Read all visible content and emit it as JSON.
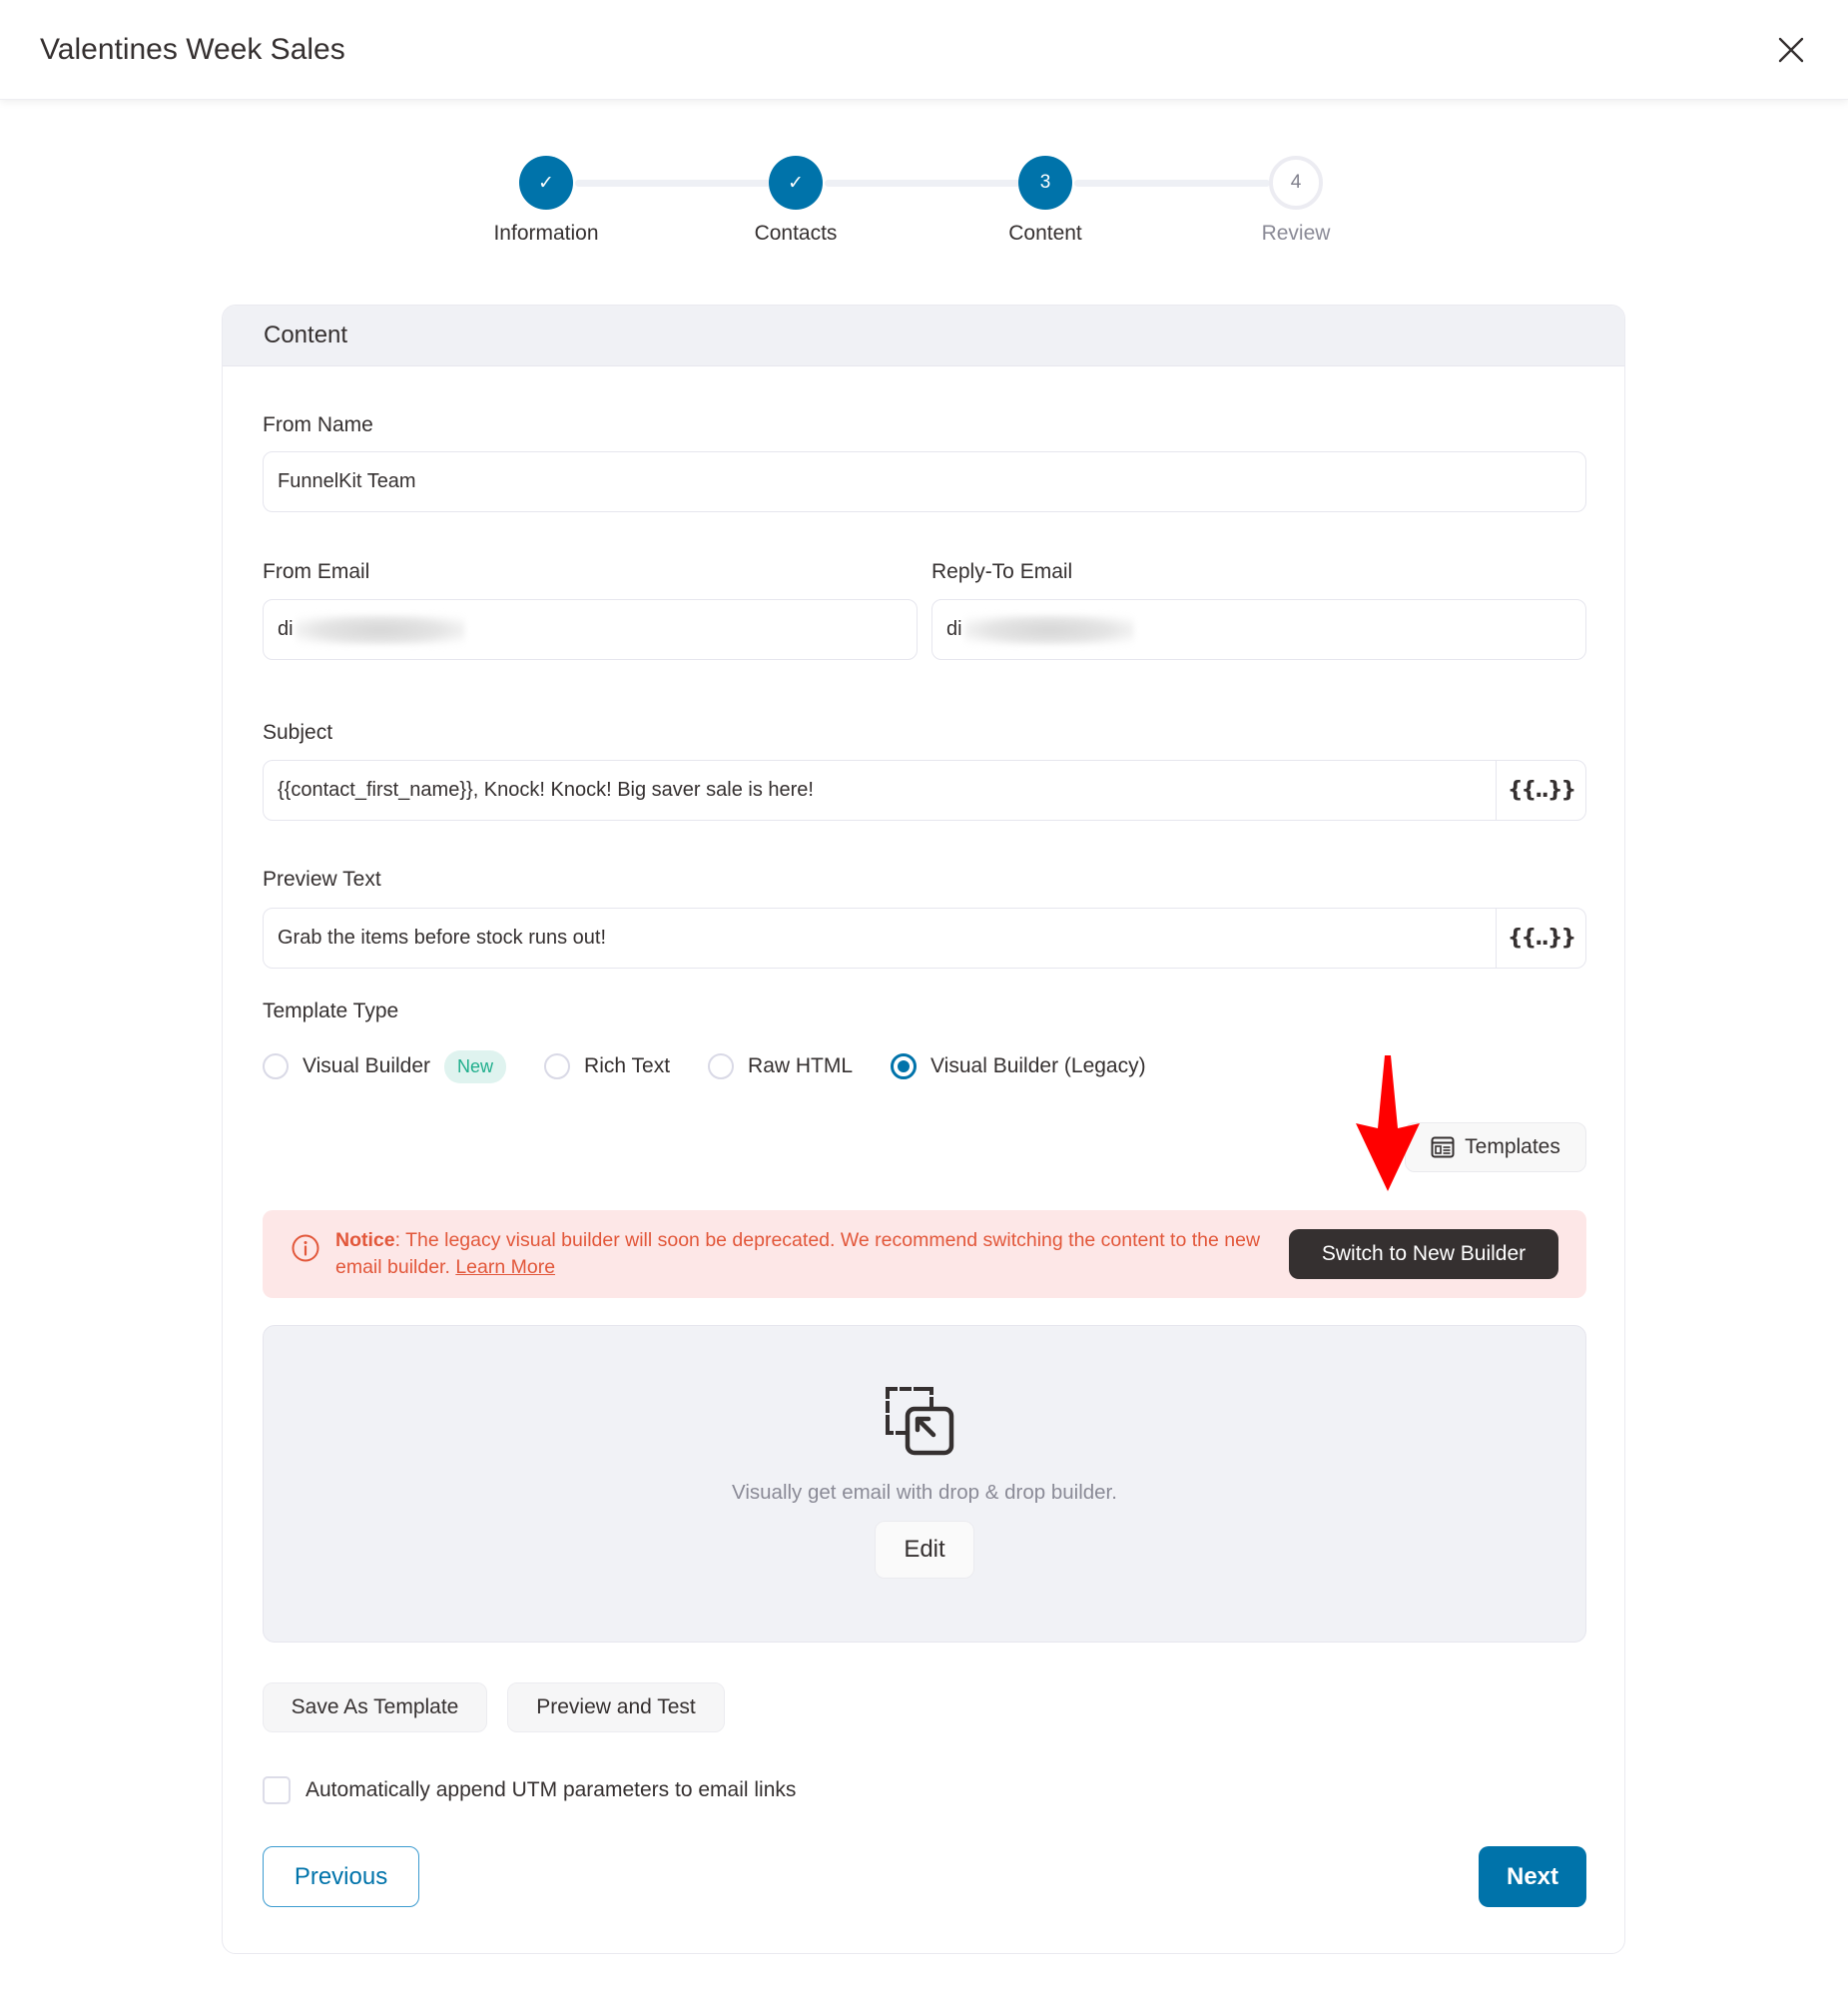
{
  "header": {
    "title": "Valentines Week Sales",
    "close_icon": "close-icon"
  },
  "stepper": {
    "steps": [
      {
        "label": "Information",
        "state": "complete",
        "marker": "✓"
      },
      {
        "label": "Contacts",
        "state": "complete",
        "marker": "✓"
      },
      {
        "label": "Content",
        "state": "current",
        "marker": "3"
      },
      {
        "label": "Review",
        "state": "upcoming",
        "marker": "4"
      }
    ],
    "current_step": 3,
    "total_steps": 4
  },
  "card": {
    "title": "Content",
    "from_name": {
      "label": "From Name",
      "value": "FunnelKit Team"
    },
    "from_email": {
      "label": "From Email",
      "value_visible": "di",
      "redacted": true
    },
    "reply_to_email": {
      "label": "Reply-To Email",
      "value_visible": "di",
      "redacted": true
    },
    "subject": {
      "label": "Subject",
      "value": "{{contact_first_name}}, Knock! Knock! Big saver sale is here!",
      "merge_tag_button": "{{..}}"
    },
    "preview_text": {
      "label": "Preview Text",
      "value": "Grab the items before stock runs out!",
      "merge_tag_button": "{{..}}"
    },
    "template_type": {
      "label": "Template Type",
      "options": [
        {
          "label": "Visual Builder",
          "badge": "New",
          "selected": false
        },
        {
          "label": "Rich Text",
          "selected": false
        },
        {
          "label": "Raw HTML",
          "selected": false
        },
        {
          "label": "Visual Builder (Legacy)",
          "selected": true
        }
      ]
    },
    "templates_button": "Templates",
    "notice": {
      "prefix": "Notice",
      "message": ": The legacy visual builder will soon be deprecated. We recommend switching the content to the new email builder. ",
      "link": "Learn More",
      "action_button": "Switch to New Builder"
    },
    "builder": {
      "hint": "Visually get email with drop & drop builder.",
      "edit_button": "Edit"
    },
    "save_as_template_button": "Save As Template",
    "preview_and_test_button": "Preview and Test",
    "utm_checkbox": {
      "label": "Automatically append UTM parameters to email links",
      "checked": false
    },
    "previous_button": "Previous",
    "next_button": "Next"
  },
  "colors": {
    "primary": "#0073aa",
    "notice_bg": "#fde7e7",
    "notice_text": "#e2573a",
    "dark_button": "#353030",
    "badge_bg": "#dff3ef",
    "badge_text": "#1fae8c",
    "annotation_arrow": "#ff0000"
  }
}
